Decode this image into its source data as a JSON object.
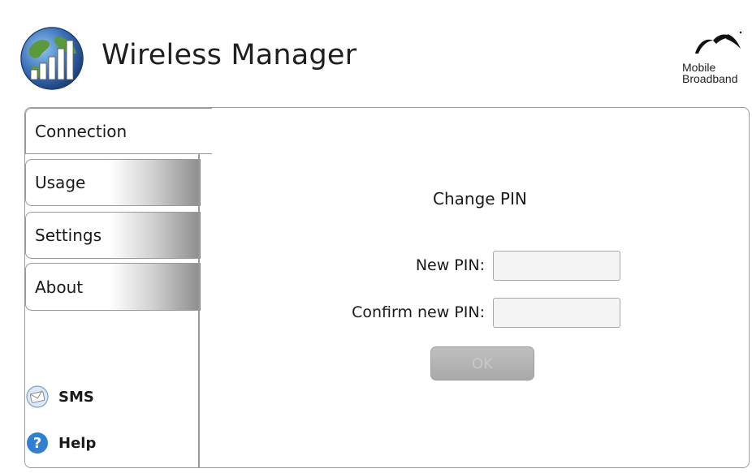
{
  "header": {
    "title": "Wireless Manager",
    "app_icon": "globe-signal-bars-icon",
    "brand": {
      "line1": "Mobile",
      "line2": "Broadband",
      "icon": "birds-logo-icon"
    }
  },
  "tabs": [
    {
      "label": "Connection",
      "active": true
    },
    {
      "label": "Usage",
      "active": false
    },
    {
      "label": "Settings",
      "active": false
    },
    {
      "label": "About",
      "active": false
    }
  ],
  "links": {
    "sms": {
      "label": "SMS",
      "icon": "sms-envelope-icon"
    },
    "help": {
      "label": "Help",
      "icon": "help-question-icon"
    }
  },
  "form": {
    "title": "Change PIN",
    "new_pin_label": "New PIN:",
    "new_pin_value": "",
    "confirm_pin_label": "Confirm new PIN:",
    "confirm_pin_value": "",
    "ok_label": "OK",
    "ok_enabled": false
  },
  "colors": {
    "panel_border": "#9a9a9a",
    "tab_gradient_end": "#8c8c8c",
    "globe_blue": "#3a6fb5",
    "globe_green": "#5a9a3a",
    "help_blue": "#2f7fd3"
  }
}
